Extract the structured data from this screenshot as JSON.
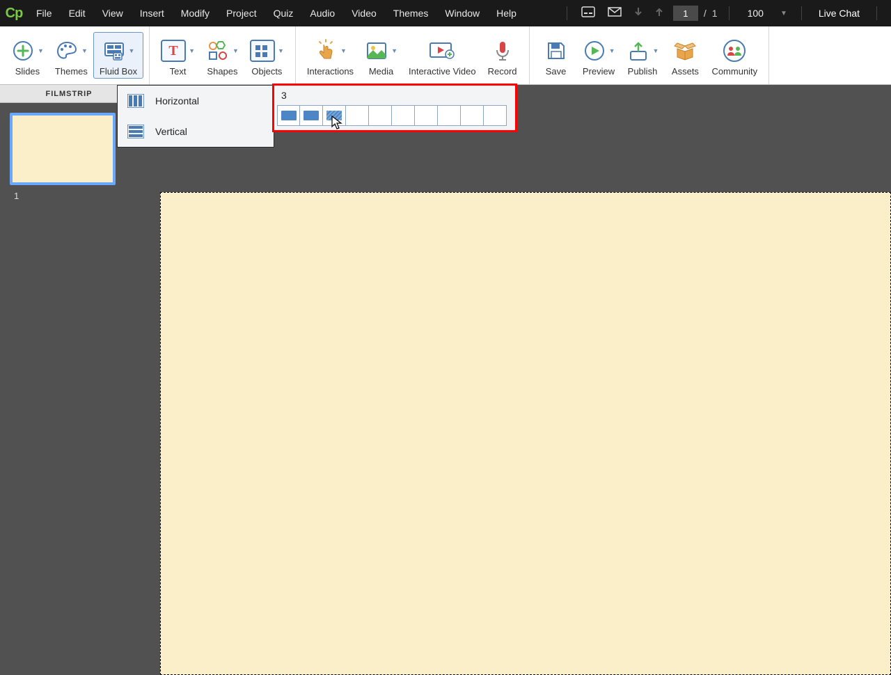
{
  "logo": "Cp",
  "menus": [
    "File",
    "Edit",
    "View",
    "Insert",
    "Modify",
    "Project",
    "Quiz",
    "Audio",
    "Video",
    "Themes",
    "Window",
    "Help"
  ],
  "slide_counter": {
    "current": "1",
    "sep": "/",
    "total": "1"
  },
  "zoom": "100",
  "live_chat": "Live Chat",
  "toolbar": {
    "slides": "Slides",
    "themes": "Themes",
    "fluidbox": "Fluid Box",
    "text": "Text",
    "shapes": "Shapes",
    "objects": "Objects",
    "interactions": "Interactions",
    "media": "Media",
    "ivideo": "Interactive Video",
    "record": "Record",
    "save": "Save",
    "preview": "Preview",
    "publish": "Publish",
    "assets": "Assets",
    "community": "Community"
  },
  "sidebar": {
    "title": "FILMSTRIP",
    "thumb_num": "1"
  },
  "fluid_dropdown": {
    "horizontal": "Horizontal",
    "vertical": "Vertical"
  },
  "col_picker": {
    "value": "3",
    "total_cells": 10,
    "filled": 3
  }
}
